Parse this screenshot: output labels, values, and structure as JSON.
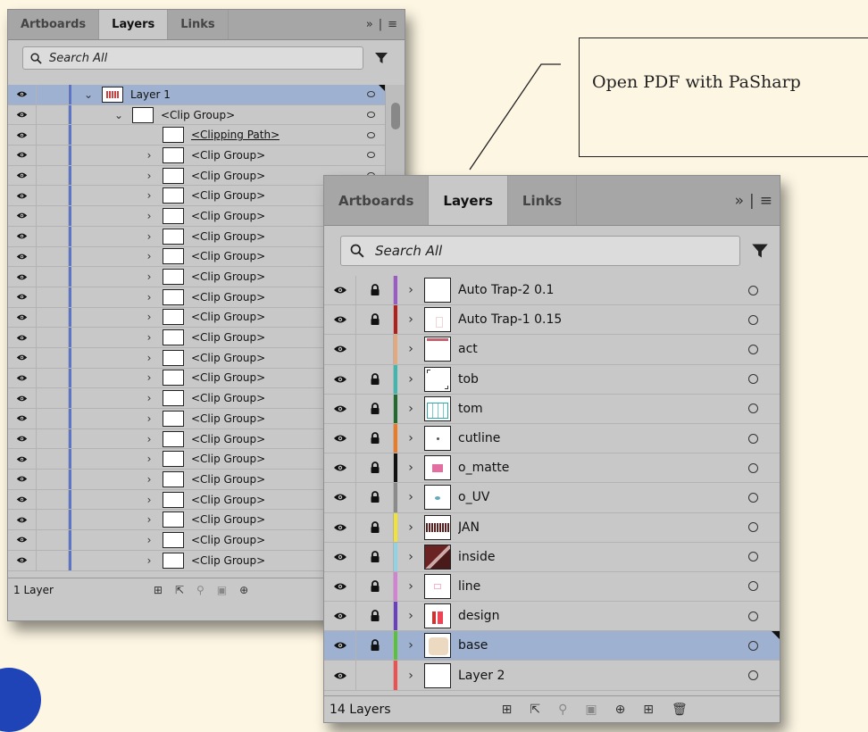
{
  "callout": {
    "text": "Open PDF with PaSharp"
  },
  "left_panel": {
    "tabs": [
      {
        "label": "Artboards"
      },
      {
        "label": "Layers",
        "active": true
      },
      {
        "label": "Links"
      }
    ],
    "overflow_label": "»",
    "search": {
      "placeholder": "Search All"
    },
    "rows": [
      {
        "label": "Layer 1",
        "indent": 0,
        "expand": "down",
        "selected": true
      },
      {
        "label": "<Clip Group>",
        "indent": 1,
        "expand": "down"
      },
      {
        "label": "<Clipping Path>",
        "indent": 2,
        "expand": "none",
        "underline": true
      },
      {
        "label": "<Clip Group>",
        "indent": 2,
        "expand": "right"
      },
      {
        "label": "<Clip Group>",
        "indent": 2,
        "expand": "right"
      },
      {
        "label": "<Clip Group>",
        "indent": 2,
        "expand": "right"
      },
      {
        "label": "<Clip Group>",
        "indent": 2,
        "expand": "right"
      },
      {
        "label": "<Clip Group>",
        "indent": 2,
        "expand": "right"
      },
      {
        "label": "<Clip Group>",
        "indent": 2,
        "expand": "right"
      },
      {
        "label": "<Clip Group>",
        "indent": 2,
        "expand": "right"
      },
      {
        "label": "<Clip Group>",
        "indent": 2,
        "expand": "right"
      },
      {
        "label": "<Clip Group>",
        "indent": 2,
        "expand": "right"
      },
      {
        "label": "<Clip Group>",
        "indent": 2,
        "expand": "right"
      },
      {
        "label": "<Clip Group>",
        "indent": 2,
        "expand": "right"
      },
      {
        "label": "<Clip Group>",
        "indent": 2,
        "expand": "right"
      },
      {
        "label": "<Clip Group>",
        "indent": 2,
        "expand": "right"
      },
      {
        "label": "<Clip Group>",
        "indent": 2,
        "expand": "right"
      },
      {
        "label": "<Clip Group>",
        "indent": 2,
        "expand": "right"
      },
      {
        "label": "<Clip Group>",
        "indent": 2,
        "expand": "right"
      },
      {
        "label": "<Clip Group>",
        "indent": 2,
        "expand": "right"
      },
      {
        "label": "<Clip Group>",
        "indent": 2,
        "expand": "right"
      },
      {
        "label": "<Clip Group>",
        "indent": 2,
        "expand": "right"
      },
      {
        "label": "<Clip Group>",
        "indent": 2,
        "expand": "right"
      },
      {
        "label": "<Clip Group>",
        "indent": 2,
        "expand": "right"
      }
    ],
    "footer": {
      "count_label": "1 Layer"
    }
  },
  "right_panel": {
    "tabs": [
      {
        "label": "Artboards"
      },
      {
        "label": "Layers",
        "active": true
      },
      {
        "label": "Links"
      }
    ],
    "overflow_label": "»",
    "search": {
      "placeholder": "Search All"
    },
    "layers": [
      {
        "name": "Auto Trap-2 0.1",
        "locked": true,
        "color": "#9b59c9",
        "thumb": "blank",
        "selected": false
      },
      {
        "name": "Auto Trap-1 0.15",
        "locked": true,
        "color": "#b3201a",
        "thumb": "faint",
        "selected": false
      },
      {
        "name": "act",
        "locked": false,
        "color": "#e8a77a",
        "thumb": "red-top",
        "selected": false
      },
      {
        "name": "tob",
        "locked": true,
        "color": "#3bb8b0",
        "thumb": "corner-marks",
        "selected": false
      },
      {
        "name": "tom",
        "locked": true,
        "color": "#1e6b2e",
        "thumb": "teal-grid",
        "selected": false
      },
      {
        "name": "cutline",
        "locked": true,
        "color": "#f07a22",
        "thumb": "dots",
        "selected": false
      },
      {
        "name": "o_matte",
        "locked": true,
        "color": "#111111",
        "thumb": "pink-art",
        "selected": false
      },
      {
        "name": "o_UV",
        "locked": true,
        "color": "#8a8a8a",
        "thumb": "blue-dot",
        "selected": false
      },
      {
        "name": "JAN",
        "locked": true,
        "color": "#f2e232",
        "thumb": "barcode",
        "selected": false
      },
      {
        "name": "inside",
        "locked": true,
        "color": "#8fd2e6",
        "thumb": "dark-art",
        "selected": false
      },
      {
        "name": "line",
        "locked": true,
        "color": "#d77ed6",
        "thumb": "faint-pink",
        "selected": false
      },
      {
        "name": "design",
        "locked": true,
        "color": "#6a3fc2",
        "thumb": "design-art",
        "selected": false
      },
      {
        "name": "base",
        "locked": true,
        "color": "#58c23c",
        "thumb": "beige",
        "selected": true
      },
      {
        "name": "Layer 2",
        "locked": false,
        "color": "#f05050",
        "thumb": "blank",
        "selected": false
      }
    ],
    "footer": {
      "count_label": "14 Layers"
    }
  }
}
